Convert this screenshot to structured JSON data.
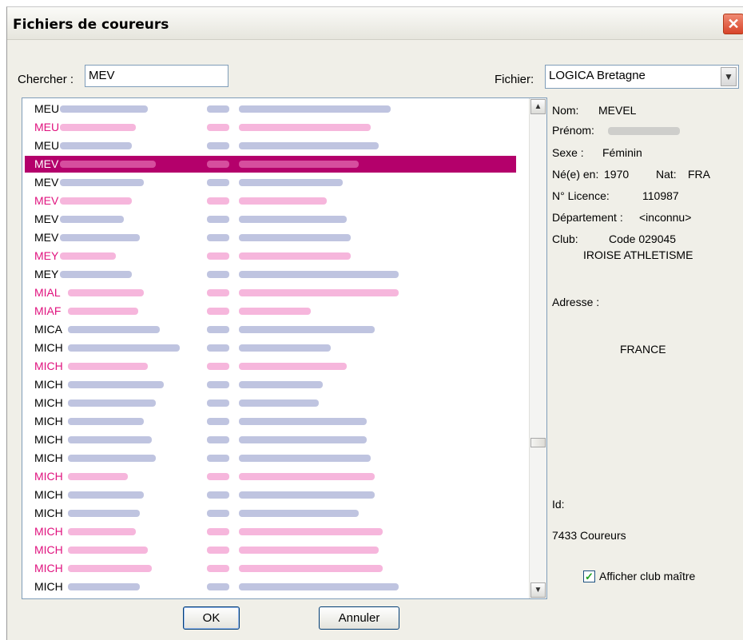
{
  "window": {
    "title": "Fichiers de coureurs",
    "close_glyph": "✕"
  },
  "search": {
    "label": "Chercher :",
    "value": "MEV"
  },
  "file": {
    "label": "Fichier:",
    "value": "LOGICA Bretagne"
  },
  "list": {
    "rows": [
      {
        "name": "MEU",
        "gender": "male"
      },
      {
        "name": "MEU",
        "gender": "female"
      },
      {
        "name": "MEU",
        "gender": "male"
      },
      {
        "name": "MEV",
        "gender": "female",
        "selected": true
      },
      {
        "name": "MEV",
        "gender": "male"
      },
      {
        "name": "MEV",
        "gender": "female"
      },
      {
        "name": "MEV",
        "gender": "male"
      },
      {
        "name": "MEV",
        "gender": "male"
      },
      {
        "name": "MEY",
        "gender": "female"
      },
      {
        "name": "MEY",
        "gender": "male"
      },
      {
        "name": "MIAL",
        "gender": "female"
      },
      {
        "name": "MIAF",
        "gender": "female"
      },
      {
        "name": "MICA",
        "gender": "male"
      },
      {
        "name": "MICH",
        "gender": "male"
      },
      {
        "name": "MICH",
        "gender": "female"
      },
      {
        "name": "MICH",
        "gender": "male"
      },
      {
        "name": "MICH",
        "gender": "male"
      },
      {
        "name": "MICH",
        "gender": "male"
      },
      {
        "name": "MICH",
        "gender": "male"
      },
      {
        "name": "MICH",
        "gender": "male"
      },
      {
        "name": "MICH",
        "gender": "female"
      },
      {
        "name": "MICH",
        "gender": "male"
      },
      {
        "name": "MICH",
        "gender": "male"
      },
      {
        "name": "MICH",
        "gender": "female"
      },
      {
        "name": "MICH",
        "gender": "female"
      },
      {
        "name": "MICH",
        "gender": "female"
      },
      {
        "name": "MICH",
        "gender": "male"
      }
    ]
  },
  "details": {
    "nom_label": "Nom:",
    "nom_value": "MEVEL",
    "prenom_label": "Prénom:",
    "sexe_label": "Sexe :",
    "sexe_value": "Féminin",
    "ne_label": "Né(e) en:",
    "ne_value": "1970",
    "nat_label": "Nat:",
    "nat_value": "FRA",
    "licence_label": "N° Licence:",
    "licence_value": "110987",
    "dept_label": "Département :",
    "dept_value": "<inconnu>",
    "club_label": "Club:",
    "club_code": "Code 029045",
    "club_name": "IROISE ATHLETISME",
    "adresse_label": "Adresse :",
    "pays": "FRANCE",
    "id_label": "Id:",
    "count": "7433 Coureurs",
    "checkbox_label": "Afficher club maître",
    "checkbox_checked": true
  },
  "buttons": {
    "ok": "OK",
    "cancel": "Annuler"
  }
}
